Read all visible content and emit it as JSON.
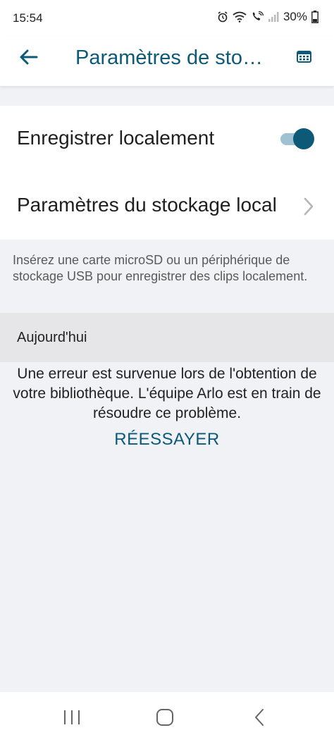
{
  "status_bar": {
    "time": "15:54",
    "battery": "30%"
  },
  "app_bar": {
    "title": "Paramètres de stoc…",
    "icons": {
      "back": "arrow-left-icon",
      "calendar": "calendar-icon"
    },
    "accent_color": "#0c5a77"
  },
  "settings": {
    "record_locally_label": "Enregistrer localement",
    "record_locally_enabled": true,
    "local_storage_label": "Paramètres du stockage local"
  },
  "info_text": "Insérez une carte microSD ou un périphérique de stockage USB pour enregistrer des clips localement.",
  "library": {
    "section_header": "Aujourd'hui",
    "error_message": "Une erreur est survenue lors de l'obtention de votre bibliothèque. L'équipe Arlo est en train de résoudre ce problème.",
    "retry_label": "RÉESSAYER"
  },
  "nav_bar": {
    "icons": [
      "recent-apps-icon",
      "home-icon",
      "back-nav-icon"
    ]
  }
}
